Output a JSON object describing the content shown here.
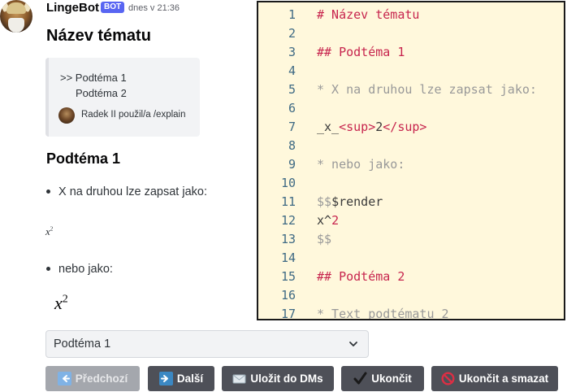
{
  "message": {
    "author": "LingeBot",
    "badge": "BOT",
    "timestamp": "dnes v 21:36",
    "title": "Název tématu"
  },
  "quote": {
    "line1": ">> Podtéma 1",
    "line2": "Podtéma 2",
    "used_command": "Radek II použil/a /explain"
  },
  "content": {
    "heading": "Podtéma 1",
    "bullet1": "X na druhou lze zapsat jako:",
    "math_small_base": "x",
    "math_small_exp": "2",
    "bullet2": "nebo jako:",
    "math_big_base": "x",
    "math_big_exp": "2"
  },
  "code_panel": {
    "lines": [
      {
        "n": "1",
        "parts": [
          {
            "t": "# Název tématu",
            "c": "red"
          }
        ]
      },
      {
        "n": "2",
        "parts": []
      },
      {
        "n": "3",
        "parts": [
          {
            "t": "## Podtéma 1",
            "c": "red"
          }
        ]
      },
      {
        "n": "4",
        "parts": []
      },
      {
        "n": "5",
        "parts": [
          {
            "t": "* X na druhou lze zapsat jako:",
            "c": "gray"
          }
        ]
      },
      {
        "n": "6",
        "parts": []
      },
      {
        "n": "7",
        "parts": [
          {
            "t": "_x_",
            "c": "dark"
          },
          {
            "t": "<sup>",
            "c": "red"
          },
          {
            "t": "2",
            "c": "dark"
          },
          {
            "t": "</sup>",
            "c": "red"
          }
        ]
      },
      {
        "n": "8",
        "parts": []
      },
      {
        "n": "9",
        "parts": [
          {
            "t": "* nebo jako:",
            "c": "gray"
          }
        ]
      },
      {
        "n": "10",
        "parts": []
      },
      {
        "n": "11",
        "parts": [
          {
            "t": "$$",
            "c": "gray"
          },
          {
            "t": "$render",
            "c": "dark"
          }
        ]
      },
      {
        "n": "12",
        "parts": [
          {
            "t": "x^",
            "c": "dark"
          },
          {
            "t": "2",
            "c": "red"
          }
        ]
      },
      {
        "n": "13",
        "parts": [
          {
            "t": "$$",
            "c": "gray"
          }
        ]
      },
      {
        "n": "14",
        "parts": []
      },
      {
        "n": "15",
        "parts": [
          {
            "t": "## Podtéma 2",
            "c": "red"
          }
        ]
      },
      {
        "n": "16",
        "parts": []
      },
      {
        "n": "17",
        "parts": [
          {
            "t": "* Text podtématu 2",
            "c": "gray"
          }
        ]
      }
    ]
  },
  "select": {
    "selected": "Podtéma 1"
  },
  "buttons": {
    "prev": "Předchozí",
    "next": "Další",
    "save_dm": "Uložit do DMs",
    "end": "Ukončit",
    "end_delete": "Ukončit a smazat"
  },
  "colors": {
    "bot_badge": "#5865f2",
    "button_bg": "#4e5058",
    "button_disabled": "#a4a7ad",
    "code_bg": "#fff8dc",
    "code_red": "#c7254e",
    "line_number": "#3f6a84"
  },
  "icons": {
    "prev": "left-arrow-icon",
    "next": "right-arrow-icon",
    "save_dm": "envelope-icon",
    "end": "check-mark-icon",
    "end_delete": "prohibited-icon",
    "select": "chevron-down-icon"
  }
}
